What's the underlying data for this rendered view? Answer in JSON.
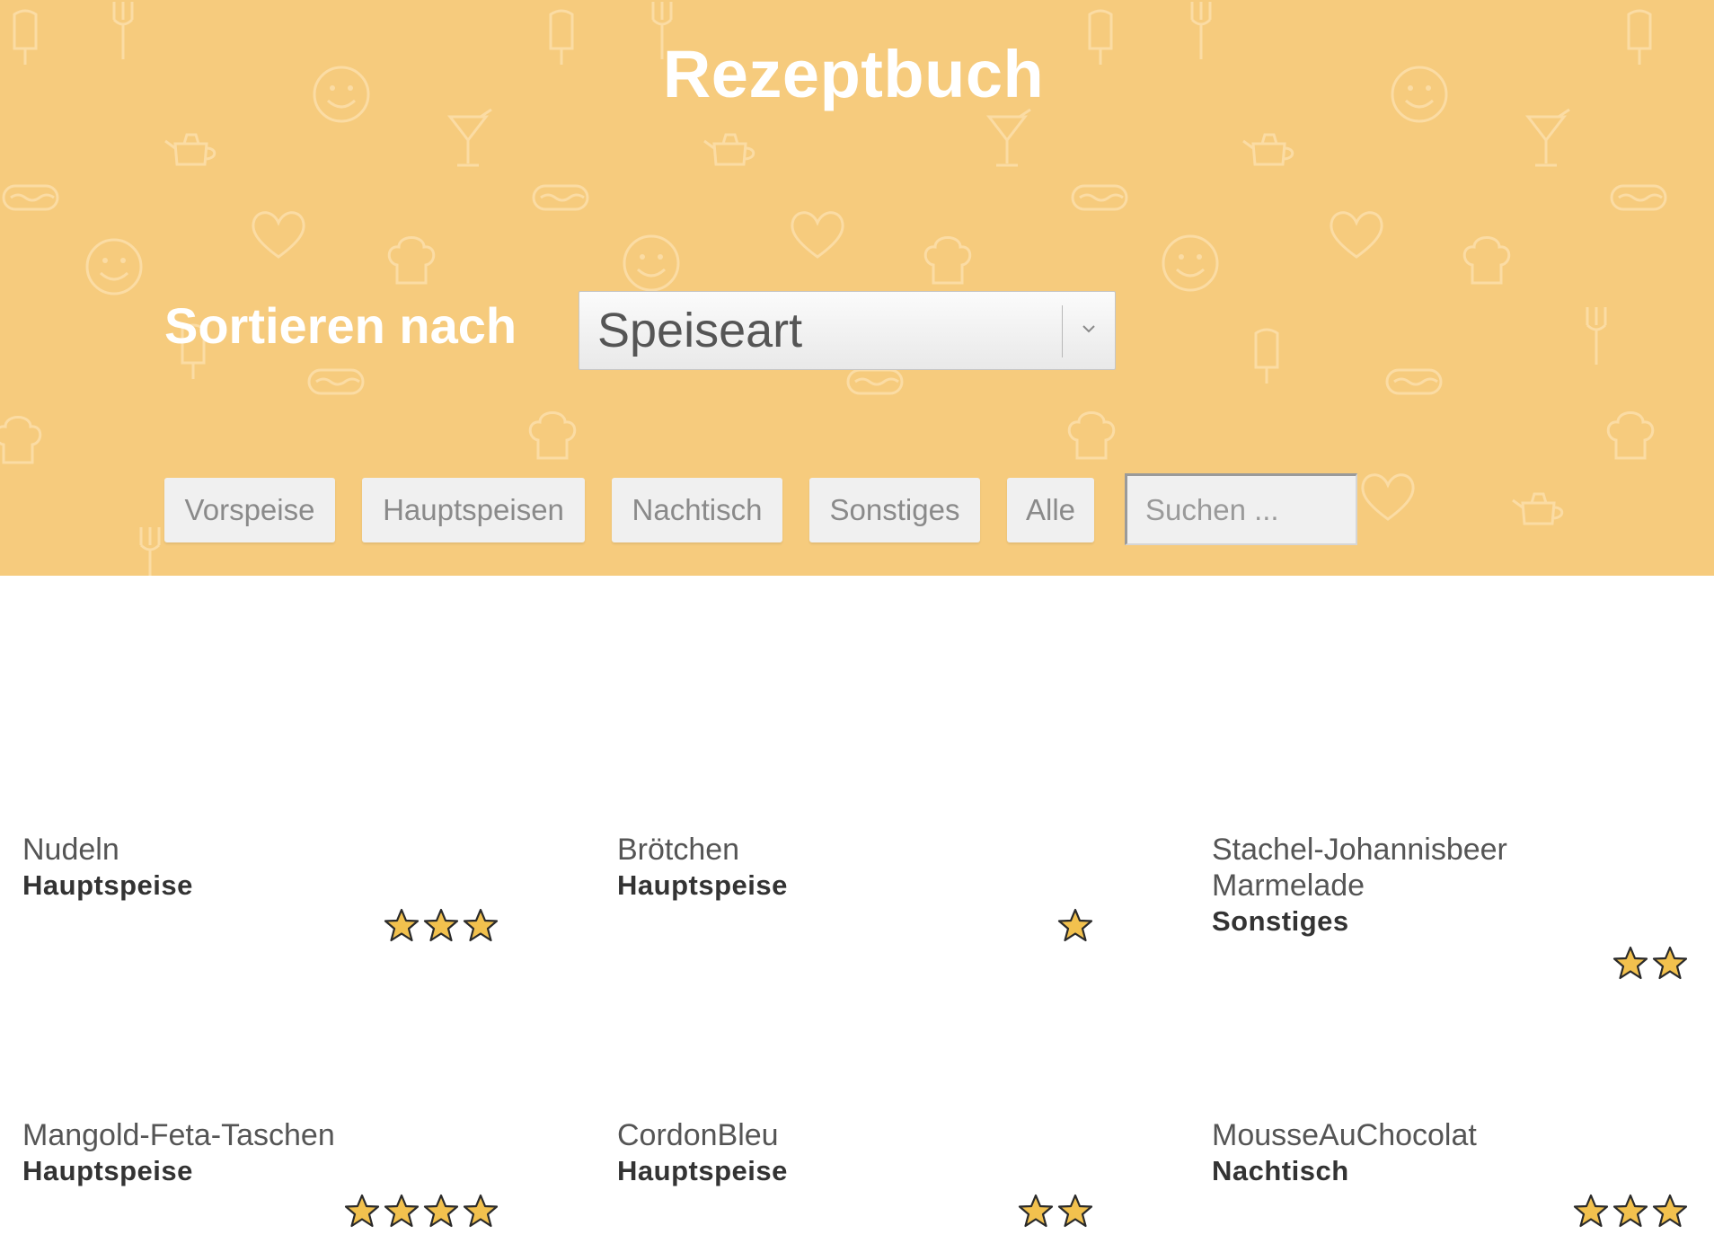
{
  "header": {
    "title": "Rezeptbuch",
    "sort_label": "Sortieren nach",
    "sort_select": {
      "value": "Speiseart"
    },
    "filters": [
      "Vorspeise",
      "Hauptspeisen",
      "Nachtisch",
      "Sonstiges",
      "Alle"
    ],
    "search": {
      "placeholder": "Suchen ...",
      "value": ""
    },
    "colors": {
      "background": "#f6cb7d",
      "title": "#ffffff"
    }
  },
  "recipes": [
    {
      "name": "Nudeln",
      "type": "Hauptspeise",
      "rating": 3
    },
    {
      "name": "Brötchen",
      "type": "Hauptspeise",
      "rating": 1
    },
    {
      "name": "Stachel-Johannisbeer Marmelade",
      "type": "Sonstiges",
      "rating": 2
    },
    {
      "name": "Mangold-Feta-Taschen",
      "type": "Hauptspeise",
      "rating": 4
    },
    {
      "name": "CordonBleu",
      "type": "Hauptspeise",
      "rating": 2
    },
    {
      "name": "MousseAuChocolat",
      "type": "Nachtisch",
      "rating": 3
    }
  ],
  "star_color": "#f2c14e"
}
